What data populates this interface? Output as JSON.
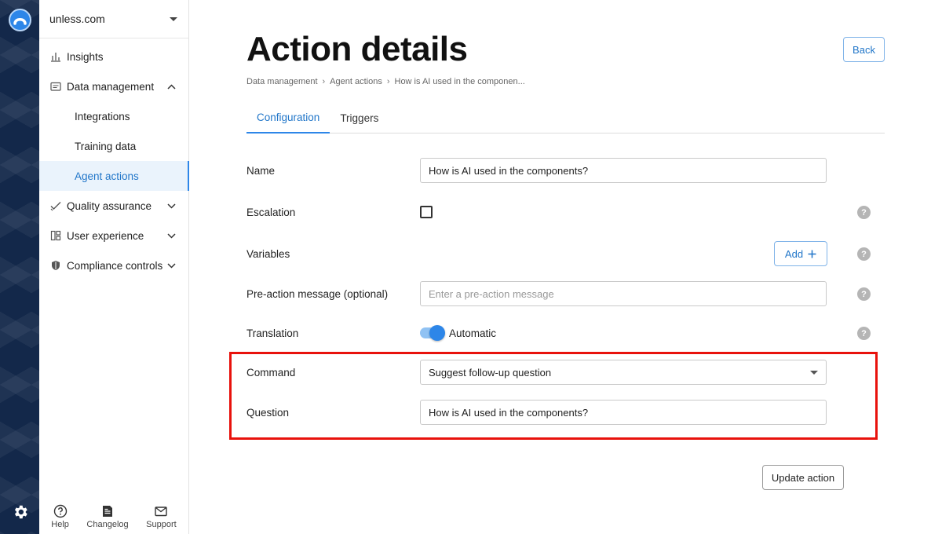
{
  "workspace": {
    "name": "unless.com"
  },
  "sidebar": {
    "items": [
      {
        "label": "Insights",
        "icon": "chart-icon"
      },
      {
        "label": "Data management",
        "icon": "folder-icon",
        "expanded": true,
        "children": [
          {
            "label": "Integrations"
          },
          {
            "label": "Training data"
          },
          {
            "label": "Agent actions",
            "active": true
          }
        ]
      },
      {
        "label": "Quality assurance",
        "icon": "check-icon"
      },
      {
        "label": "User experience",
        "icon": "layout-icon"
      },
      {
        "label": "Compliance controls",
        "icon": "shield-icon"
      }
    ],
    "footer": [
      {
        "label": "Help",
        "icon": "help-circle-icon"
      },
      {
        "label": "Changelog",
        "icon": "document-icon"
      },
      {
        "label": "Support",
        "icon": "mail-icon"
      }
    ]
  },
  "page": {
    "title": "Action details",
    "back_label": "Back",
    "breadcrumb": [
      "Data management",
      "Agent actions",
      "How is AI used in the componen..."
    ],
    "tabs": [
      {
        "label": "Configuration",
        "active": true
      },
      {
        "label": "Triggers",
        "active": false
      }
    ]
  },
  "form": {
    "name": {
      "label": "Name",
      "value": "How is AI used in the components?"
    },
    "escalation": {
      "label": "Escalation",
      "checked": false
    },
    "variables": {
      "label": "Variables",
      "add_label": "Add"
    },
    "pre_action": {
      "label": "Pre-action message (optional)",
      "placeholder": "Enter a pre-action message",
      "value": ""
    },
    "translation": {
      "label": "Translation",
      "toggle_label": "Automatic",
      "on": true
    },
    "command": {
      "label": "Command",
      "value": "Suggest follow-up question"
    },
    "question": {
      "label": "Question",
      "value": "How is AI used in the components?"
    },
    "help_glyph": "?",
    "update_label": "Update action"
  },
  "colors": {
    "accent": "#2d86e8",
    "highlight": "#e8120c",
    "rail": "#13284a"
  }
}
